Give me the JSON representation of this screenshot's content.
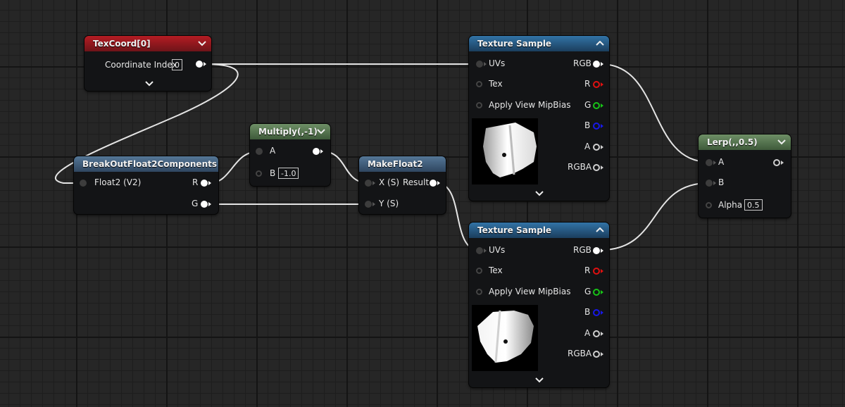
{
  "nodes": {
    "texcoord": {
      "title": "TexCoord[0]",
      "coordinate_label": "Coordinate Index",
      "coordinate_value": "0",
      "header_color": "#b51c23"
    },
    "break": {
      "title": "BreakOutFloat2Components",
      "input": "Float2 (V2)",
      "out_r": "R",
      "out_g": "G"
    },
    "multiply": {
      "title": "Multiply(,-1)",
      "in_a": "A",
      "in_b": "B",
      "b_value": "-1.0"
    },
    "make": {
      "title": "MakeFloat2",
      "in_x": "X (S)",
      "in_y": "Y (S)",
      "out": "Result"
    },
    "tex1": {
      "title": "Texture Sample",
      "uvs": "UVs",
      "tex": "Tex",
      "mip": "Apply View MipBias",
      "rgb": "RGB",
      "r": "R",
      "g": "G",
      "b": "B",
      "a": "A",
      "rgba": "RGBA"
    },
    "tex2": {
      "title": "Texture Sample",
      "uvs": "UVs",
      "tex": "Tex",
      "mip": "Apply View MipBias",
      "rgb": "RGB",
      "r": "R",
      "g": "G",
      "b": "B",
      "a": "A",
      "rgba": "RGBA"
    },
    "lerp": {
      "title": "Lerp(,,0.5)",
      "in_a": "A",
      "in_b": "B",
      "alpha": "Alpha",
      "alpha_value": "0.5"
    }
  },
  "colors": {
    "red_pin": "#e01010",
    "green_pin": "#17c417",
    "blue_pin": "#1818e8",
    "wire": "#e8e8e8"
  }
}
